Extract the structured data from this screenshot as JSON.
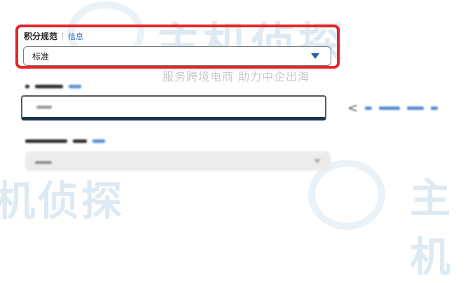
{
  "watermark": {
    "brand_text": "主机侦探",
    "brand_text_top": "主机侦探",
    "brand_text_bottom_left": "机侦探",
    "brand_text_bottom_right": "主机",
    "tagline": "服务跨境电商 助力中企出海",
    "color": "#c7dcec"
  },
  "form": {
    "points_field": {
      "label": "积分规范",
      "info_link": "信息",
      "selected_value": "标准",
      "highlight_color": "#e8232a",
      "accent_color": "#1e5fa6"
    },
    "field_two": {},
    "field_three": {}
  },
  "icons": {
    "dropdown": "chevron-down-icon",
    "share": "share-icon"
  }
}
